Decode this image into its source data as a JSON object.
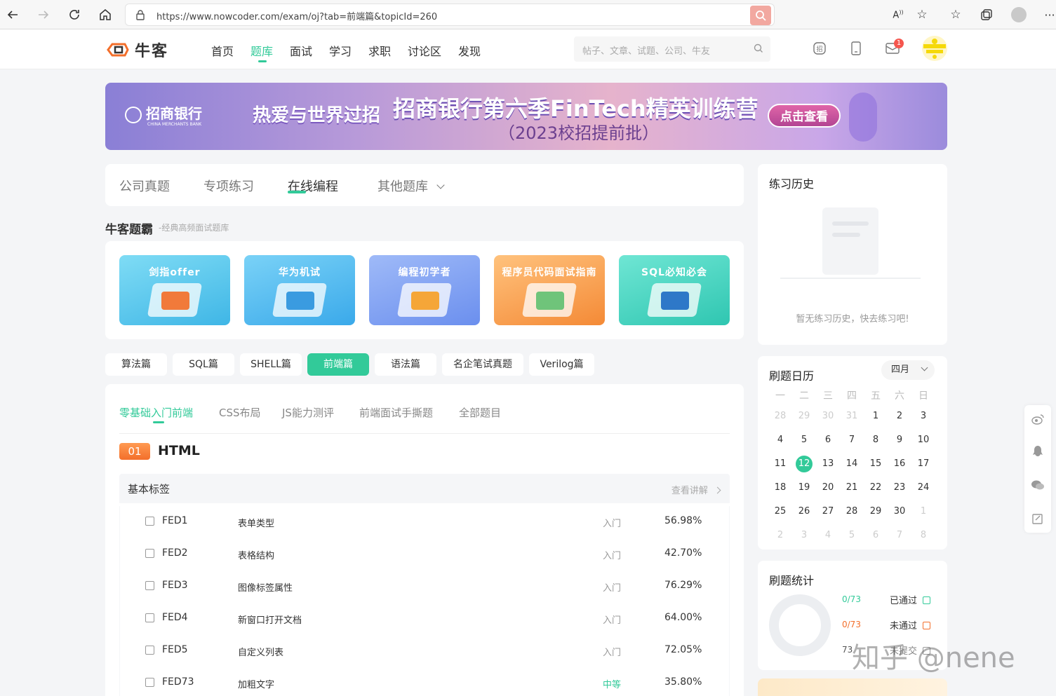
{
  "browser": {
    "url": "https://www.nowcoder.com/exam/oj?tab=前端篇&topicId=260"
  },
  "header": {
    "logo": "牛客",
    "nav": [
      "首页",
      "题库",
      "面试",
      "学习",
      "求职",
      "讨论区",
      "发现"
    ],
    "active_nav": "题库",
    "search_placeholder": "帖子、文章、试题、公司、牛友",
    "message_badge": "1"
  },
  "banner": {
    "bank_name": "招商银行",
    "bank_en": "CHINA MERCHANTS BANK",
    "slogan": "热爱与世界过招",
    "title": "招商银行第六季FinTech精英训练营",
    "subtitle": "（2023校招提前批）",
    "button": "点击查看"
  },
  "main_tabs": {
    "items": [
      "公司真题",
      "专项练习",
      "在线编程",
      "其他题库"
    ],
    "active": "在线编程"
  },
  "section": {
    "title": "牛客题霸",
    "subtitle": "-经典高频面试题库"
  },
  "books": [
    {
      "label": "剑指offer",
      "color": "#4fc6ea"
    },
    {
      "label": "华为机试",
      "color": "#45b8ee"
    },
    {
      "label": "编程初学者",
      "color": "#6f9cf0"
    },
    {
      "label": "程序员代码面试指南",
      "color": "#f7a04c"
    },
    {
      "label": "SQL必知必会",
      "color": "#3cd6c0"
    }
  ],
  "pills": {
    "items": [
      "算法篇",
      "SQL篇",
      "SHELL篇",
      "前端篇",
      "语法篇",
      "名企笔试真题",
      "Verilog篇"
    ],
    "active": "前端篇"
  },
  "list": {
    "subtabs": [
      "零基础入门前端",
      "CSS布局",
      "JS能力测评",
      "前端面试手撕题",
      "全部题目"
    ],
    "active_subtab": "零基础入门前端",
    "chapter_no": "01",
    "chapter_title": "HTML",
    "group_title": "基本标签",
    "group_link": "查看讲解",
    "rows": [
      {
        "id": "FED1",
        "name": "表单类型",
        "level": "入门",
        "pct": "56.98%"
      },
      {
        "id": "FED2",
        "name": "表格结构",
        "level": "入门",
        "pct": "42.70%"
      },
      {
        "id": "FED3",
        "name": "图像标签属性",
        "level": "入门",
        "pct": "76.29%"
      },
      {
        "id": "FED4",
        "name": "新窗口打开文档",
        "level": "入门",
        "pct": "64.00%"
      },
      {
        "id": "FED5",
        "name": "自定义列表",
        "level": "入门",
        "pct": "72.05%"
      },
      {
        "id": "FED73",
        "name": "加粗文字",
        "level": "中等",
        "pct": "35.80%"
      }
    ]
  },
  "history": {
    "title": "练习历史",
    "empty_text": "暂无练习历史，快去练习吧!"
  },
  "calendar": {
    "title": "刷题日历",
    "month": "四月",
    "weekdays": [
      "一",
      "二",
      "三",
      "四",
      "五",
      "六",
      "日"
    ],
    "weeks": [
      [
        "28",
        "29",
        "30",
        "31",
        "1",
        "2",
        "3"
      ],
      [
        "4",
        "5",
        "6",
        "7",
        "8",
        "9",
        "10"
      ],
      [
        "11",
        "12",
        "13",
        "14",
        "15",
        "16",
        "17"
      ],
      [
        "18",
        "19",
        "20",
        "21",
        "22",
        "23",
        "24"
      ],
      [
        "25",
        "26",
        "27",
        "28",
        "29",
        "30",
        "1"
      ],
      [
        "2",
        "3",
        "4",
        "5",
        "6",
        "7",
        "8"
      ]
    ],
    "today": "12"
  },
  "stats": {
    "title": "刷题统计",
    "passed_count": "0/73",
    "passed_label": "已通过",
    "failed_count": "0/73",
    "failed_label": "未通过",
    "unsubmitted_count": "73",
    "unsubmitted_label": "未提交"
  },
  "watermark": "知乎 @nene",
  "colors": {
    "brand": "#32ca99",
    "accent_orange": "#f36f2b"
  }
}
